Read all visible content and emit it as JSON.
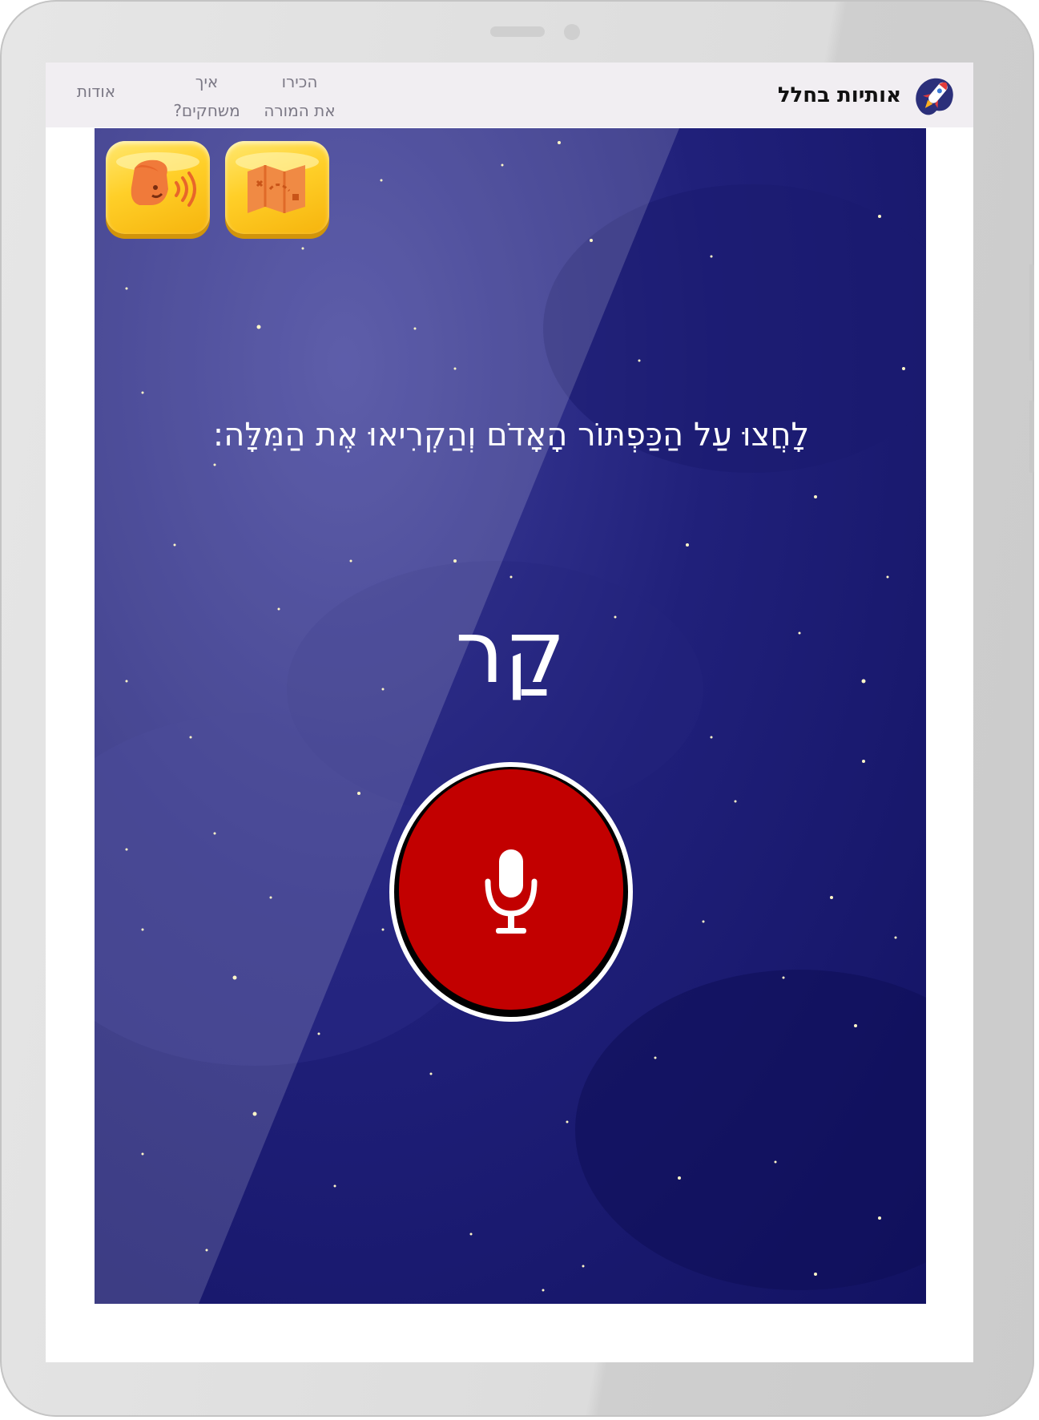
{
  "header": {
    "brand_name": "אותיות בחלל",
    "nav": {
      "meet_teacher": [
        "הכירו",
        "את המורה"
      ],
      "how_to_play": [
        "איך",
        "משחקים?"
      ],
      "about": "אודות"
    }
  },
  "game": {
    "instruction": "לָחֲצוּ עַל הַכַּפְתּוֹר הָאָדֹם וְהַקְרִיאוּ אֶת הַמִּלָּה:",
    "word": "קַר",
    "tiles": [
      {
        "icon": "speaking-face-icon"
      },
      {
        "icon": "map-icon"
      }
    ],
    "mic_icon": "microphone-icon"
  },
  "colors": {
    "mic_red": "#c20000",
    "tile_yellow": "#ffcf28",
    "sky_dark": "#121262",
    "topbar": "#f1eef2"
  }
}
